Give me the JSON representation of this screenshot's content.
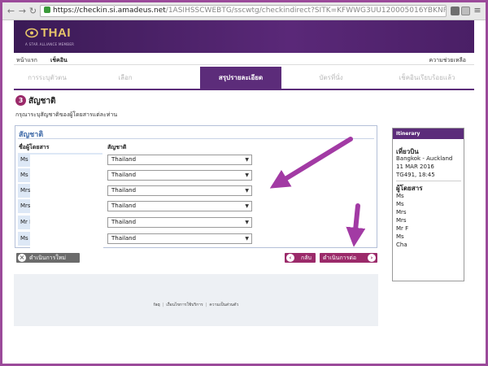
{
  "browser": {
    "url_host": "https://checkin.si.amadeus.net",
    "url_path": "/1ASIHSSCWEBTG/sscwtg/checkindirect?SITK=KFWWG3UU120005016YBKNPG"
  },
  "brand": {
    "logo_text": "THAI",
    "tagline": "A STAR ALLIANCE MEMBER",
    "purple": "#5c2c7a",
    "magenta": "#9b2a6a"
  },
  "topnav": {
    "home": "หน้าแรก",
    "checkin": "เช็คอิน",
    "help": "ความช่วยเหลือ"
  },
  "steps": [
    {
      "label": "การระบุตัวตน",
      "active": false
    },
    {
      "label": "เลือก",
      "active": false
    },
    {
      "label": "สรุปรายละเอียด",
      "active": true
    },
    {
      "label": "บัตรที่นั่ง",
      "active": false
    },
    {
      "label": "เช็คอินเรียบร้อยแล้ว",
      "active": false
    }
  ],
  "page": {
    "step_number": "3",
    "title": "สัญชาติ",
    "instructions": "กรุณาระบุสัญชาติของผู้โดยสารแต่ละท่าน"
  },
  "panel": {
    "title": "สัญชาติ",
    "col_passenger": "ชื่อผู้โดยสาร",
    "col_nationality": "สัญชาติ",
    "rows": [
      {
        "name": "Ms S",
        "nationality": "Thailand"
      },
      {
        "name": "Ms C",
        "nationality": "Thailand"
      },
      {
        "name": "Mrs",
        "nationality": "Thailand"
      },
      {
        "name": "Mrs",
        "nationality": "Thailand"
      },
      {
        "name": "Mr F",
        "nationality": "Thailand"
      },
      {
        "name": "Ms C",
        "nationality": "Thailand"
      }
    ]
  },
  "buttons": {
    "new_session": "ดำเนินการใหม่",
    "back": "กลับ",
    "next": "ดำเนินการต่อ"
  },
  "itinerary": {
    "header": "Itinerary",
    "departure_label": "เที่ยวบิน",
    "route": "Bangkok - Auckland",
    "date": "11 MAR 2016",
    "flight": "TG491, 18:45",
    "passengers_label": "ผู้โดยสาร",
    "passengers": [
      "Ms",
      "Ms",
      "Mrs",
      "Mrs",
      "Mr F",
      "Ms",
      "Cha"
    ]
  },
  "footer": {
    "links": [
      "faq",
      "เงื่อนไขการใช้บริการ",
      "ความเป็นส่วนตัว"
    ]
  }
}
